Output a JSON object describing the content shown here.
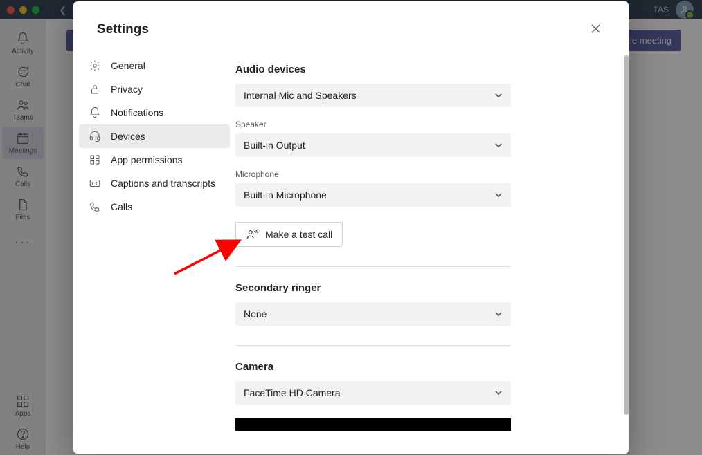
{
  "window": {
    "user_initials": "TAS"
  },
  "left_rail": {
    "items": [
      {
        "label": "Activity"
      },
      {
        "label": "Chat"
      },
      {
        "label": "Teams"
      },
      {
        "label": "Meetings"
      },
      {
        "label": "Calls"
      },
      {
        "label": "Files"
      }
    ],
    "bottom": [
      {
        "label": "Apps"
      },
      {
        "label": "Help"
      }
    ]
  },
  "toolbar": {
    "schedule_label": "Schedule meeting"
  },
  "settings": {
    "title": "Settings",
    "nav": [
      {
        "label": "General"
      },
      {
        "label": "Privacy"
      },
      {
        "label": "Notifications"
      },
      {
        "label": "Devices"
      },
      {
        "label": "App permissions"
      },
      {
        "label": "Captions and transcripts"
      },
      {
        "label": "Calls"
      }
    ],
    "devices": {
      "audio_heading": "Audio devices",
      "audio_device_value": "Internal Mic and Speakers",
      "speaker_label": "Speaker",
      "speaker_value": "Built-in Output",
      "mic_label": "Microphone",
      "mic_value": "Built-in Microphone",
      "test_call_label": "Make a test call",
      "secondary_ringer_heading": "Secondary ringer",
      "secondary_ringer_value": "None",
      "camera_heading": "Camera",
      "camera_value": "FaceTime HD Camera"
    }
  }
}
